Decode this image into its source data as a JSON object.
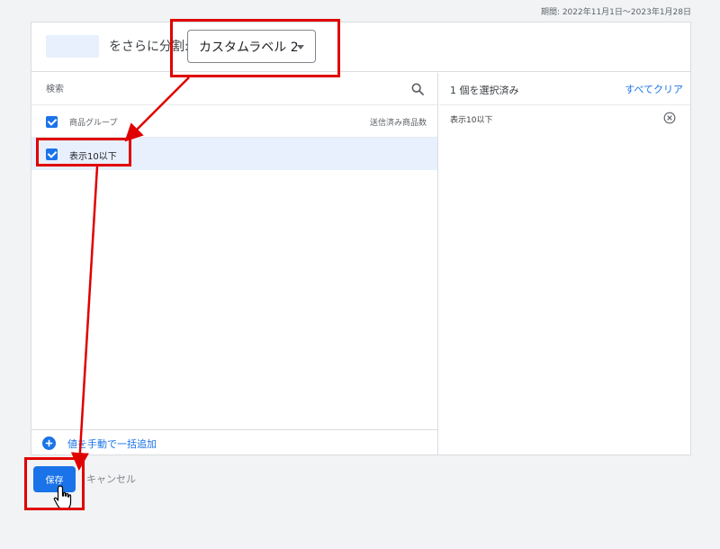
{
  "period": "期間: 2022年11月1日～2023年1月28日",
  "header": {
    "split_label": "をさらに分割:",
    "dimension_value": "カスタムラベル 2"
  },
  "left": {
    "search_placeholder": "検索",
    "column_group": "商品グループ",
    "column_count": "送信済み商品数",
    "items": [
      {
        "label": "表示10以下",
        "checked": true
      }
    ],
    "bulk_add": "値を手動で一括追加"
  },
  "right": {
    "selected_count": "1 個を選択済み",
    "clear_all": "すべてクリア",
    "selected_items": [
      {
        "label": "表示10以下"
      }
    ]
  },
  "footer": {
    "save": "保存",
    "cancel": "キャンセル"
  },
  "colors": {
    "accent": "#1a73e8",
    "selected_row": "#e8f0fe",
    "annotation": "#e00000"
  }
}
